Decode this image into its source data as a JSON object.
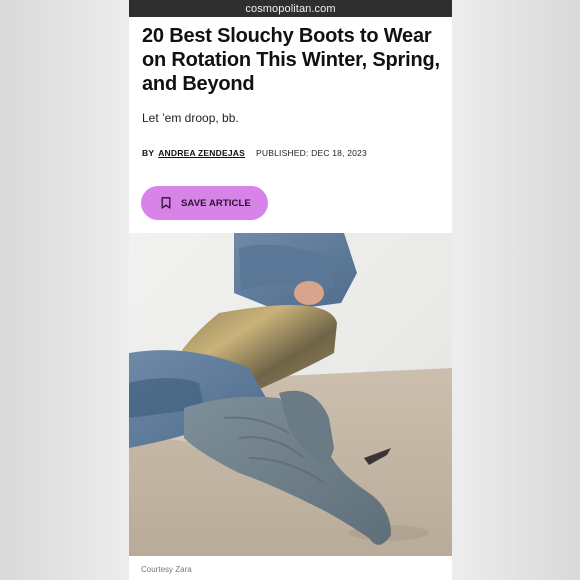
{
  "browser": {
    "url": "cosmopolitan.com"
  },
  "article": {
    "headline": "20 Best Slouchy Boots to Wear on Rotation This Winter, Spring, and Beyond",
    "dek": "Let ’em droop, bb.",
    "byline_prefix": "BY",
    "author": "ANDREA ZENDEJAS",
    "published": "PUBLISHED: DEC 18, 2023",
    "save_label": "SAVE ARTICLE",
    "save_icon": "bookmark-icon",
    "image_credit": "Courtesy Zara"
  },
  "colors": {
    "accent": "#d883e8",
    "url_bar": "#2f2f2f"
  }
}
